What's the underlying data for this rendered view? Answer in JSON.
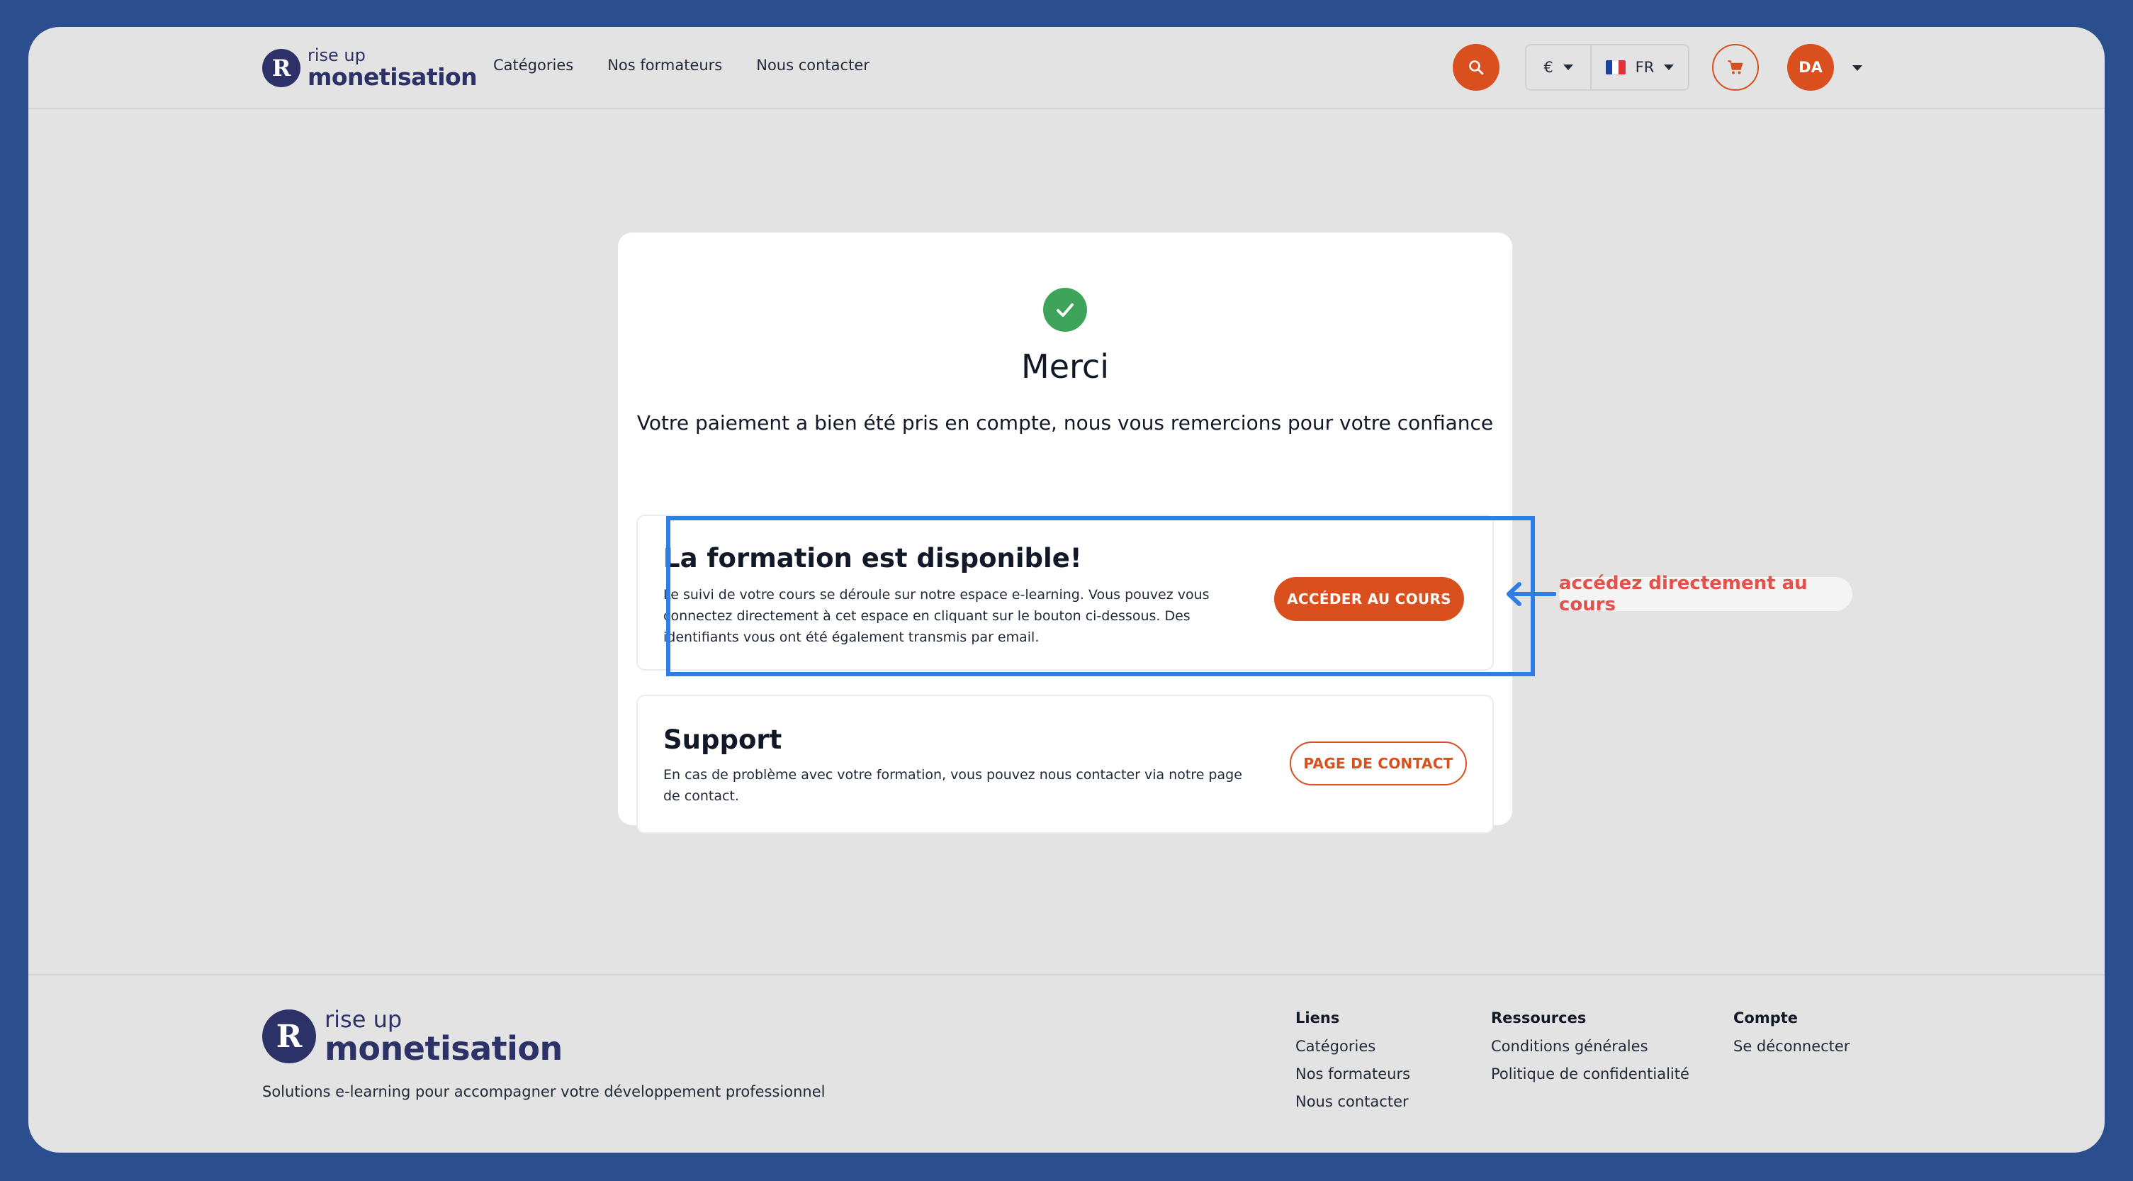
{
  "brand": {
    "mark": "R",
    "top": "rise up",
    "bottom": "monetisation"
  },
  "header": {
    "nav": [
      "Catégories",
      "Nos formateurs",
      "Nous contacter"
    ],
    "currency": "€",
    "language": "FR",
    "avatar_initials": "DA",
    "icons": [
      "search-icon",
      "cart-icon",
      "chevron-down-icon",
      "france-flag-icon"
    ]
  },
  "confirmation": {
    "title": "Merci",
    "subtitle": "Votre paiement a bien été pris en compte, nous vous remercions pour votre confiance"
  },
  "course_panel": {
    "title": "La formation est disponible!",
    "text": "Le suivi de votre cours se déroule sur notre espace e-learning. Vous pouvez vous connectez directement à cet espace en cliquant sur le bouton ci-dessous. Des identifiants vous ont été également transmis par email.",
    "button": "ACCÉDER AU COURS"
  },
  "support_panel": {
    "title": "Support",
    "text": "En cas de problème avec votre formation, vous pouvez nous contacter via notre page de contact.",
    "button": "PAGE DE CONTACT"
  },
  "annotation": {
    "callout": "accédez directement au cours"
  },
  "footer": {
    "tagline": "Solutions e-learning pour accompagner votre développement professionnel",
    "columns": [
      {
        "title": "Liens",
        "links": [
          "Catégories",
          "Nos formateurs",
          "Nous contacter"
        ]
      },
      {
        "title": "Ressources",
        "links": [
          "Conditions générales",
          "Politique de confidentialité"
        ]
      },
      {
        "title": "Compte",
        "links": [
          "Se déconnecter"
        ]
      }
    ]
  },
  "colors": {
    "accent": "#d9501e",
    "brand": "#2c3268",
    "success": "#3fa45b",
    "highlight": "#2f7de6",
    "callout_text": "#e2524a",
    "outer_background": "#2b4e8e"
  }
}
